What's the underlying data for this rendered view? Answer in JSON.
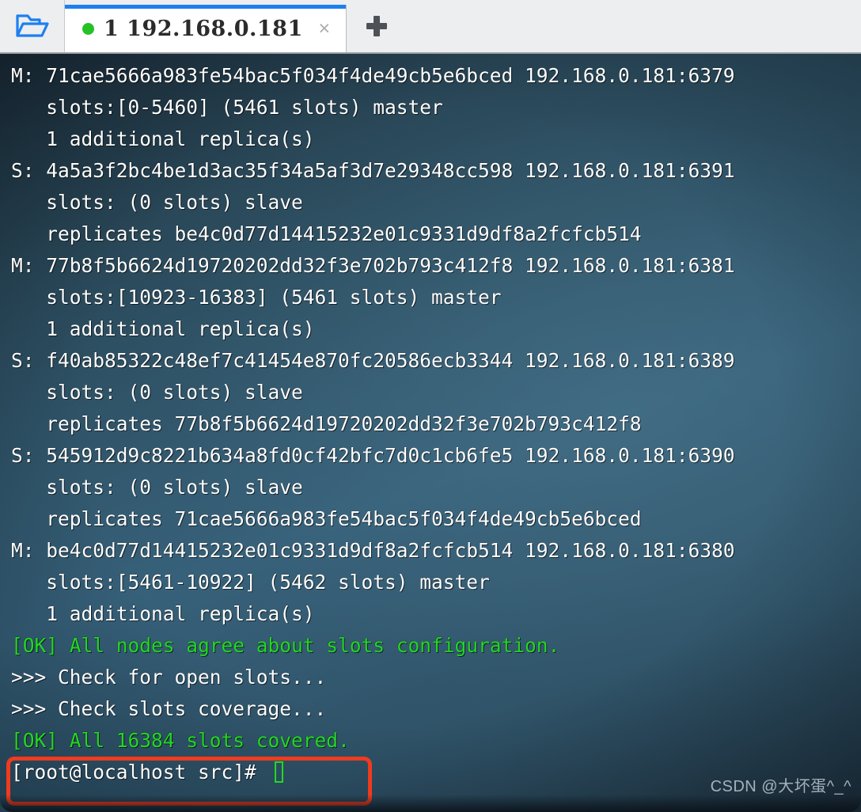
{
  "window": {
    "folder_icon": "open-folder-icon",
    "new_tab_icon": "plus-icon",
    "tabs": [
      {
        "status_dot": "green-status-dot",
        "label": "1 192.168.0.181",
        "close_label": "×",
        "active": true
      }
    ]
  },
  "colors": {
    "tab_accent": "#1d7ff0",
    "status_dot": "#25c225",
    "terminal_text": "#ffffff",
    "terminal_ok": "#23d723",
    "highlight_border": "#ef3b1e",
    "folder_icon": "#1d7ff0"
  },
  "terminal": {
    "lines": [
      {
        "text": "M: 71cae5666a983fe54bac5f034f4de49cb5e6bced 192.168.0.181:6379",
        "style": "normal"
      },
      {
        "text": "   slots:[0-5460] (5461 slots) master",
        "style": "normal"
      },
      {
        "text": "   1 additional replica(s)",
        "style": "normal"
      },
      {
        "text": "S: 4a5a3f2bc4be1d3ac35f34a5af3d7e29348cc598 192.168.0.181:6391",
        "style": "normal"
      },
      {
        "text": "   slots: (0 slots) slave",
        "style": "normal"
      },
      {
        "text": "   replicates be4c0d77d14415232e01c9331d9df8a2fcfcb514",
        "style": "normal"
      },
      {
        "text": "M: 77b8f5b6624d19720202dd32f3e702b793c412f8 192.168.0.181:6381",
        "style": "normal"
      },
      {
        "text": "   slots:[10923-16383] (5461 slots) master",
        "style": "normal"
      },
      {
        "text": "   1 additional replica(s)",
        "style": "normal"
      },
      {
        "text": "S: f40ab85322c48ef7c41454e870fc20586ecb3344 192.168.0.181:6389",
        "style": "normal"
      },
      {
        "text": "   slots: (0 slots) slave",
        "style": "normal"
      },
      {
        "text": "   replicates 77b8f5b6624d19720202dd32f3e702b793c412f8",
        "style": "normal"
      },
      {
        "text": "S: 545912d9c8221b634a8fd0cf42bfc7d0c1cb6fe5 192.168.0.181:6390",
        "style": "normal"
      },
      {
        "text": "   slots: (0 slots) slave",
        "style": "normal"
      },
      {
        "text": "   replicates 71cae5666a983fe54bac5f034f4de49cb5e6bced",
        "style": "normal"
      },
      {
        "text": "M: be4c0d77d14415232e01c9331d9df8a2fcfcb514 192.168.0.181:6380",
        "style": "normal"
      },
      {
        "text": "   slots:[5461-10922] (5462 slots) master",
        "style": "normal"
      },
      {
        "text": "   1 additional replica(s)",
        "style": "normal"
      },
      {
        "text": "[OK] All nodes agree about slots configuration.",
        "style": "ok"
      },
      {
        "text": ">>> Check for open slots...",
        "style": "normal"
      },
      {
        "text": ">>> Check slots coverage...",
        "style": "normal"
      },
      {
        "text": "[OK] All 16384 slots covered.",
        "style": "ok"
      },
      {
        "text": "[root@localhost src]# ",
        "style": "prompt"
      }
    ],
    "cursor": "block-cursor"
  },
  "annotation": {
    "highlight_target": "[OK] All 16384 slots covered."
  },
  "watermark": {
    "text": "CSDN @大坏蛋^_^"
  }
}
